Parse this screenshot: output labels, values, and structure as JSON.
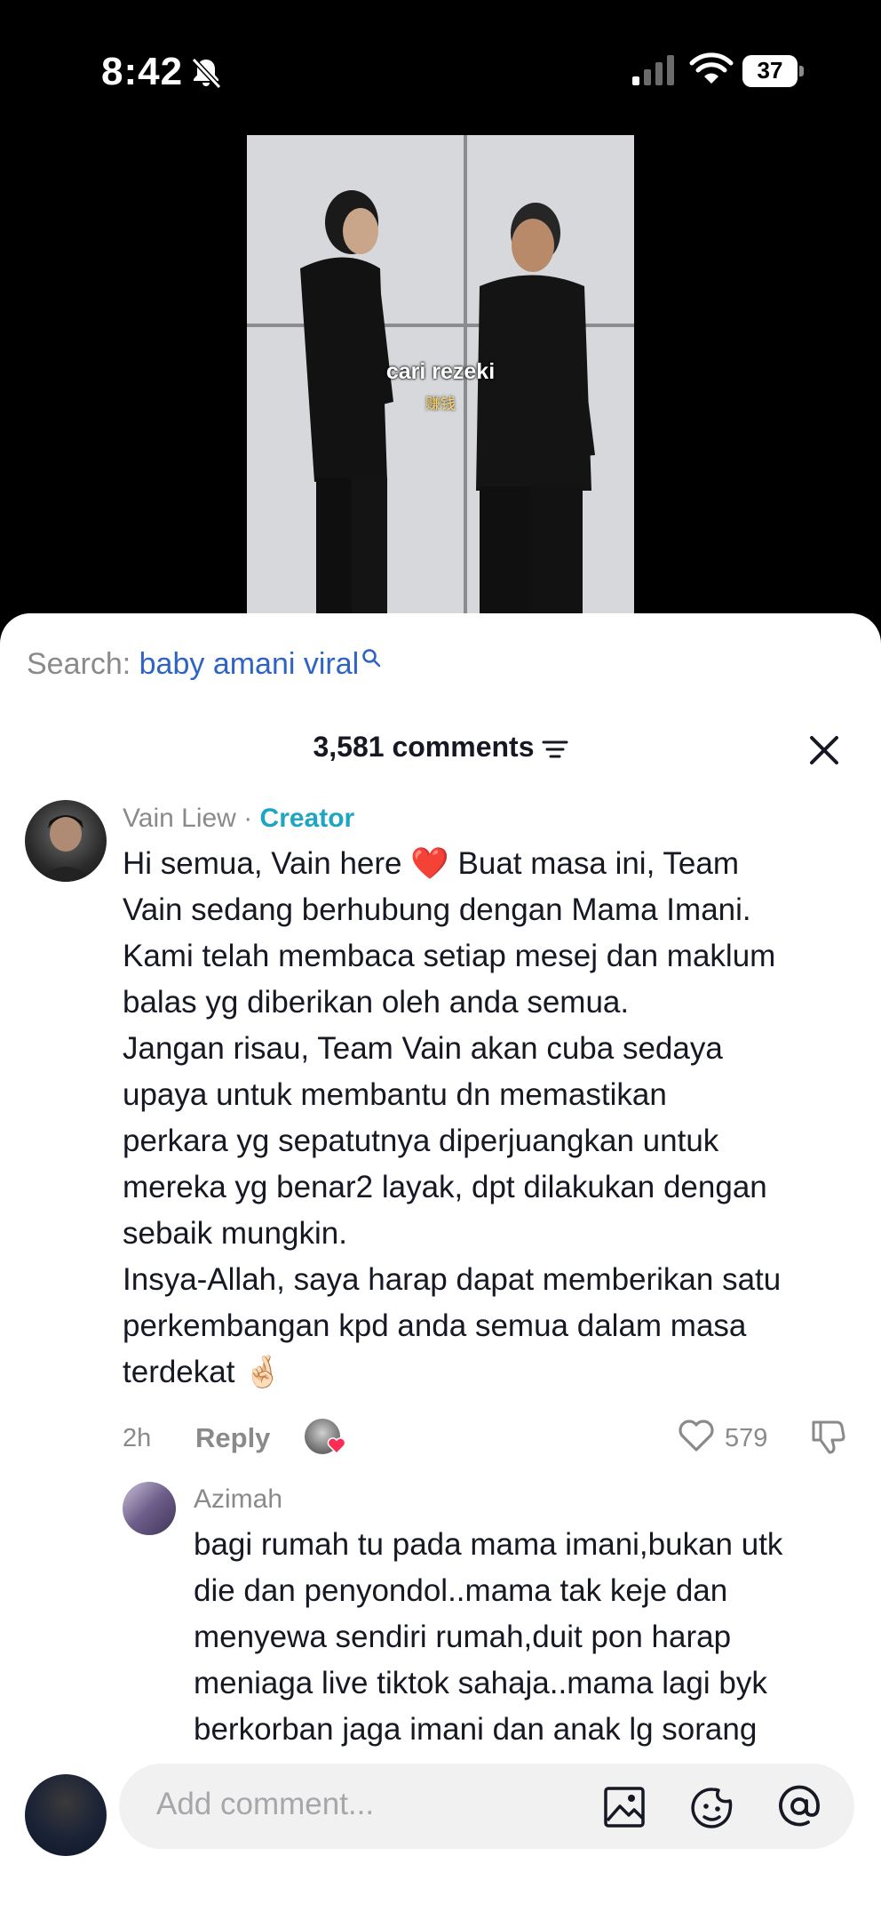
{
  "status_bar": {
    "time": "8:42",
    "battery": "37",
    "icons": [
      "bell-slash-icon",
      "cellular-signal-icon",
      "wifi-icon",
      "battery-icon"
    ]
  },
  "video": {
    "caption": "cari rezeki",
    "caption_sub": "赚钱"
  },
  "search": {
    "label": "Search:",
    "term": "baby amani viral"
  },
  "comments": {
    "count_label": "3,581 comments",
    "top": {
      "author": "Vain Liew",
      "separator": " · ",
      "badge": "Creator",
      "lines": [
        "Hi semua, Vain here ❤️ Buat masa ini, Team",
        "Vain sedang berhubung dengan Mama Imani.",
        "Kami telah membaca setiap mesej dan maklum",
        "balas yg diberikan oleh anda semua.",
        "Jangan risau, Team Vain akan cuba sedaya",
        "upaya untuk membantu dn memastikan",
        "perkara yg sepatutnya diperjuangkan untuk",
        "mereka yg benar2 layak, dpt dilakukan dengan",
        "sebaik mungkin.",
        "Insya-Allah, saya harap dapat memberikan satu",
        "perkembangan kpd anda semua dalam masa",
        "terdekat 🤞🏻"
      ],
      "age": "2h",
      "reply_label": "Reply",
      "likes": "579"
    },
    "reply": {
      "author": "Azimah",
      "lines": [
        "bagi rumah tu pada mama imani,bukan utk",
        "die dan penyondol..mama tak keje dan",
        "menyewa sendiri rumah,duit pon harap",
        "meniaga live tiktok sahaja..mama lagi byk",
        "berkorban jaga imani dan anak lg sorang"
      ]
    }
  },
  "composer": {
    "placeholder": "Add comment..."
  },
  "colors": {
    "accent_link": "#2f63c4",
    "creator_badge": "#1ea5c2",
    "heart_red": "#fe2c55"
  }
}
